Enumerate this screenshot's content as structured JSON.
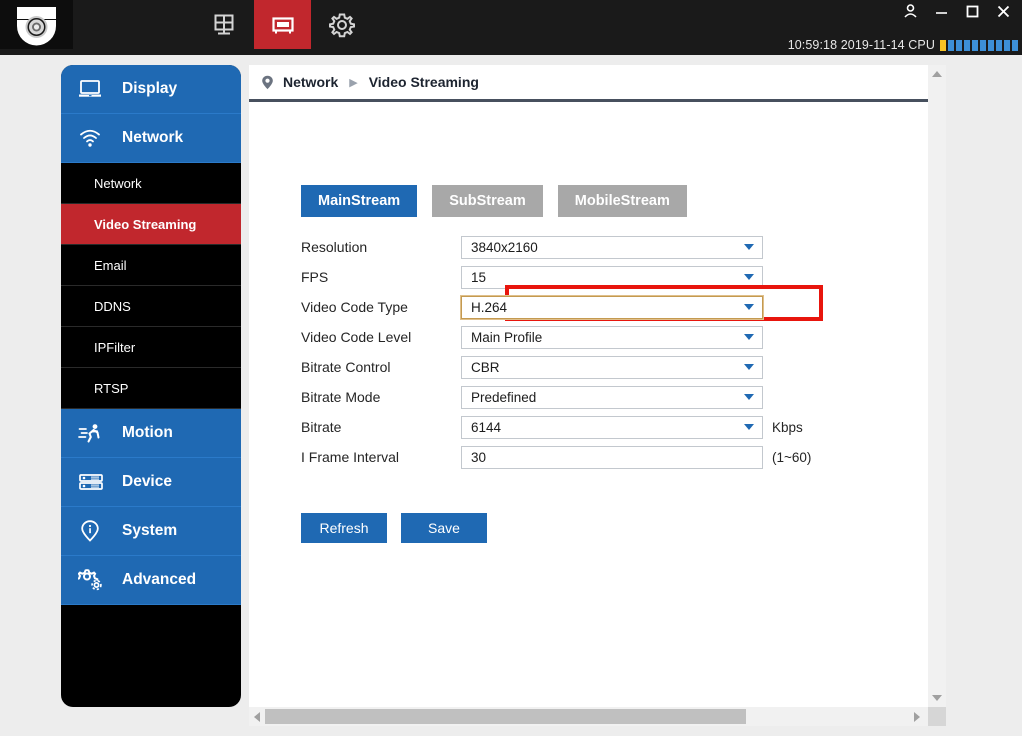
{
  "titlebar": {
    "logo_name": "dome-camera-logo",
    "nav_icons": [
      {
        "name": "grid-layout-icon",
        "active": false
      },
      {
        "name": "device-panel-icon",
        "active": true
      },
      {
        "name": "gear-icon",
        "active": false
      }
    ],
    "window_controls": [
      {
        "name": "user-account-icon",
        "label": "user"
      },
      {
        "name": "minimize-icon",
        "label": "minimize"
      },
      {
        "name": "maximize-icon",
        "label": "maximize"
      },
      {
        "name": "close-icon",
        "label": "close"
      }
    ],
    "status_text": "10:59:18 2019-11-14 CPU",
    "cpu_bars": 10,
    "cpu_warn_index": 0,
    "colors": {
      "bar_normal": "#3d8fd6",
      "bar_warn": "#f7c325",
      "accent_red": "#c1272d",
      "titlebar_bg": "#1a1a1a"
    }
  },
  "sidebar": {
    "items": [
      {
        "type": "group",
        "label": "Display",
        "icon": "monitor-icon",
        "active": false
      },
      {
        "type": "group",
        "label": "Network",
        "icon": "wifi-icon",
        "active": true
      },
      {
        "type": "sub",
        "label": "Network",
        "active": false
      },
      {
        "type": "sub",
        "label": "Video Streaming",
        "active": true
      },
      {
        "type": "sub",
        "label": "Email",
        "active": false
      },
      {
        "type": "sub",
        "label": "DDNS",
        "active": false
      },
      {
        "type": "sub",
        "label": "IPFilter",
        "active": false
      },
      {
        "type": "sub",
        "label": "RTSP",
        "active": false
      },
      {
        "type": "group",
        "label": "Motion",
        "icon": "running-person-icon",
        "active": false
      },
      {
        "type": "group",
        "label": "Device",
        "icon": "server-icon",
        "active": false
      },
      {
        "type": "group",
        "label": "System",
        "icon": "info-pin-icon",
        "active": false
      },
      {
        "type": "group",
        "label": "Advanced",
        "icon": "gears-icon",
        "active": false
      }
    ]
  },
  "breadcrumb": {
    "pin_icon": "location-pin-icon",
    "parent": "Network",
    "separator": "▶",
    "current": "Video Streaming"
  },
  "tabs": [
    {
      "label": "MainStream",
      "active": true
    },
    {
      "label": "SubStream",
      "active": false
    },
    {
      "label": "MobileStream",
      "active": false
    }
  ],
  "form": {
    "fields": [
      {
        "label": "Resolution",
        "value": "3840x2160",
        "control": "select",
        "unit": "",
        "highlighted": false
      },
      {
        "label": "FPS",
        "value": "15",
        "control": "select",
        "unit": "",
        "highlighted": false
      },
      {
        "label": "Video Code Type",
        "value": "H.264",
        "control": "select",
        "unit": "",
        "highlighted": true
      },
      {
        "label": "Video Code Level",
        "value": "Main Profile",
        "control": "select",
        "unit": "",
        "highlighted": false
      },
      {
        "label": "Bitrate Control",
        "value": "CBR",
        "control": "select",
        "unit": "",
        "highlighted": false
      },
      {
        "label": "Bitrate Mode",
        "value": "Predefined",
        "control": "select",
        "unit": "",
        "highlighted": false
      },
      {
        "label": "Bitrate",
        "value": "6144",
        "control": "select",
        "unit": "Kbps",
        "highlighted": false
      },
      {
        "label": "I Frame Interval",
        "value": "30",
        "control": "input",
        "unit": "(1~60)",
        "highlighted": false
      }
    ],
    "highlight_color": "#e8150d"
  },
  "buttons": {
    "refresh": "Refresh",
    "save": "Save"
  },
  "scrollbars": {
    "vertical": {
      "up_icon": "caret-up-icon",
      "down_icon": "caret-down-icon"
    },
    "horizontal": {
      "left_icon": "caret-left-icon",
      "right_icon": "caret-right-icon"
    }
  }
}
